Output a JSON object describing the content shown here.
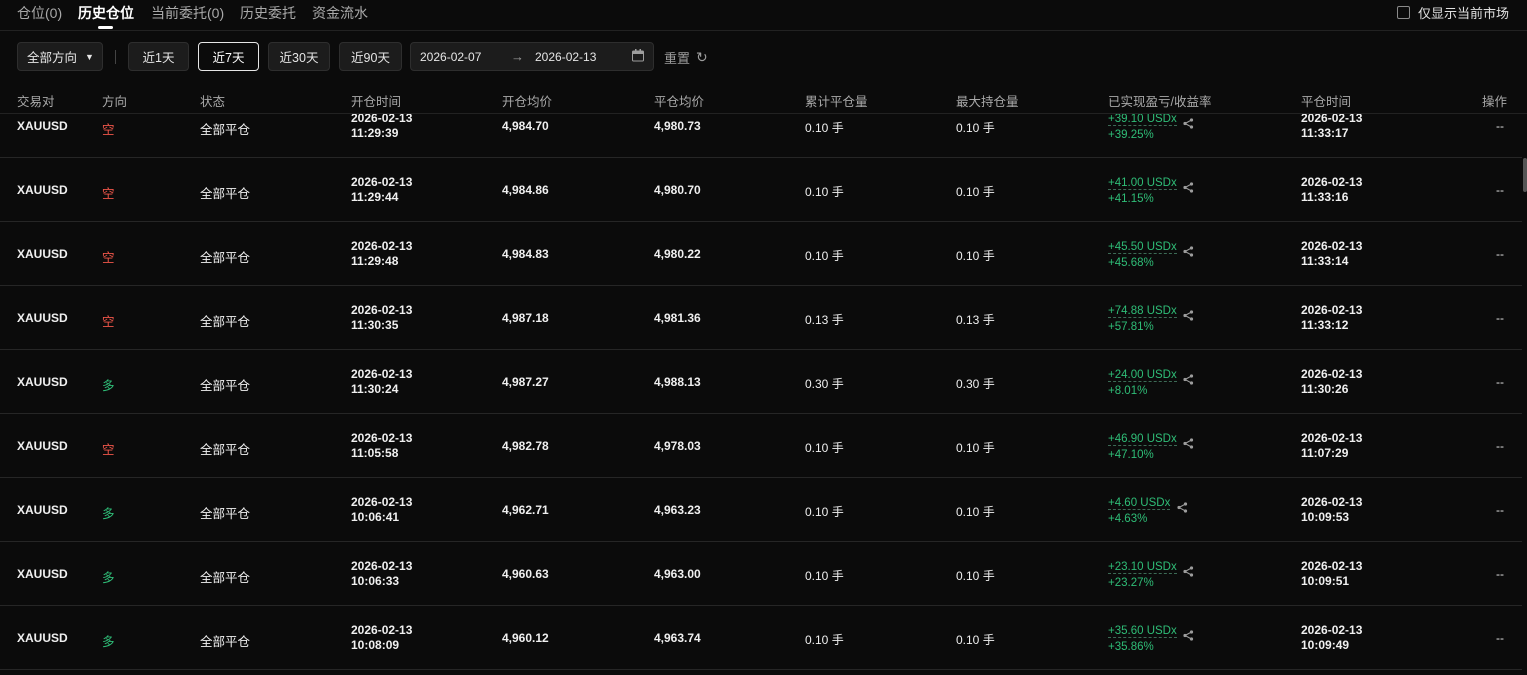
{
  "tabs": {
    "positions": "仓位(0)",
    "history_positions": "历史仓位",
    "current_orders": "当前委托(0)",
    "history_orders": "历史委托",
    "fund_flow": "资金流水"
  },
  "only_current_market": "仅显示当前市场",
  "filters": {
    "direction": "全部方向",
    "day1": "近1天",
    "day7": "近7天",
    "day30": "近30天",
    "day90": "近90天",
    "date_from": "2026-02-07",
    "arrow": "→",
    "date_to": "2026-02-13",
    "reset": "重置"
  },
  "columns": {
    "pair": "交易对",
    "direction": "方向",
    "status": "状态",
    "open_time": "开仓时间",
    "open_avg": "开仓均价",
    "close_avg": "平仓均价",
    "cum_close": "累计平仓量",
    "max_hold": "最大持仓量",
    "pnl": "已实现盈亏/收益率",
    "close_time": "平仓时间",
    "action": "操作"
  },
  "colors": {
    "short": "#f0564a",
    "long": "#2fbd77",
    "background": "#0b0b0b"
  },
  "rows": [
    {
      "pair": "XAUUSD",
      "dir": "空",
      "type": "short",
      "status": "全部平仓",
      "open_date": "2026-02-13",
      "open_time": "11:29:39",
      "open_avg": "4,984.70",
      "close_avg": "4,980.73",
      "cum": "0.10 手",
      "max": "0.10 手",
      "pnl": "+39.10 USDx",
      "rate": "+39.25%",
      "close_date": "2026-02-13",
      "close_time": "11:33:17",
      "op": "--"
    },
    {
      "pair": "XAUUSD",
      "dir": "空",
      "type": "short",
      "status": "全部平仓",
      "open_date": "2026-02-13",
      "open_time": "11:29:44",
      "open_avg": "4,984.86",
      "close_avg": "4,980.70",
      "cum": "0.10 手",
      "max": "0.10 手",
      "pnl": "+41.00 USDx",
      "rate": "+41.15%",
      "close_date": "2026-02-13",
      "close_time": "11:33:16",
      "op": "--"
    },
    {
      "pair": "XAUUSD",
      "dir": "空",
      "type": "short",
      "status": "全部平仓",
      "open_date": "2026-02-13",
      "open_time": "11:29:48",
      "open_avg": "4,984.83",
      "close_avg": "4,980.22",
      "cum": "0.10 手",
      "max": "0.10 手",
      "pnl": "+45.50 USDx",
      "rate": "+45.68%",
      "close_date": "2026-02-13",
      "close_time": "11:33:14",
      "op": "--"
    },
    {
      "pair": "XAUUSD",
      "dir": "空",
      "type": "short",
      "status": "全部平仓",
      "open_date": "2026-02-13",
      "open_time": "11:30:35",
      "open_avg": "4,987.18",
      "close_avg": "4,981.36",
      "cum": "0.13 手",
      "max": "0.13 手",
      "pnl": "+74.88 USDx",
      "rate": "+57.81%",
      "close_date": "2026-02-13",
      "close_time": "11:33:12",
      "op": "--"
    },
    {
      "pair": "XAUUSD",
      "dir": "多",
      "type": "long",
      "status": "全部平仓",
      "open_date": "2026-02-13",
      "open_time": "11:30:24",
      "open_avg": "4,987.27",
      "close_avg": "4,988.13",
      "cum": "0.30 手",
      "max": "0.30 手",
      "pnl": "+24.00 USDx",
      "rate": "+8.01%",
      "close_date": "2026-02-13",
      "close_time": "11:30:26",
      "op": "--"
    },
    {
      "pair": "XAUUSD",
      "dir": "空",
      "type": "short",
      "status": "全部平仓",
      "open_date": "2026-02-13",
      "open_time": "11:05:58",
      "open_avg": "4,982.78",
      "close_avg": "4,978.03",
      "cum": "0.10 手",
      "max": "0.10 手",
      "pnl": "+46.90 USDx",
      "rate": "+47.10%",
      "close_date": "2026-02-13",
      "close_time": "11:07:29",
      "op": "--"
    },
    {
      "pair": "XAUUSD",
      "dir": "多",
      "type": "long",
      "status": "全部平仓",
      "open_date": "2026-02-13",
      "open_time": "10:06:41",
      "open_avg": "4,962.71",
      "close_avg": "4,963.23",
      "cum": "0.10 手",
      "max": "0.10 手",
      "pnl": "+4.60 USDx",
      "rate": "+4.63%",
      "close_date": "2026-02-13",
      "close_time": "10:09:53",
      "op": "--"
    },
    {
      "pair": "XAUUSD",
      "dir": "多",
      "type": "long",
      "status": "全部平仓",
      "open_date": "2026-02-13",
      "open_time": "10:06:33",
      "open_avg": "4,960.63",
      "close_avg": "4,963.00",
      "cum": "0.10 手",
      "max": "0.10 手",
      "pnl": "+23.10 USDx",
      "rate": "+23.27%",
      "close_date": "2026-02-13",
      "close_time": "10:09:51",
      "op": "--"
    },
    {
      "pair": "XAUUSD",
      "dir": "多",
      "type": "long",
      "status": "全部平仓",
      "open_date": "2026-02-13",
      "open_time": "10:08:09",
      "open_avg": "4,960.12",
      "close_avg": "4,963.74",
      "cum": "0.10 手",
      "max": "0.10 手",
      "pnl": "+35.60 USDx",
      "rate": "+35.86%",
      "close_date": "2026-02-13",
      "close_time": "10:09:49",
      "op": "--"
    }
  ]
}
